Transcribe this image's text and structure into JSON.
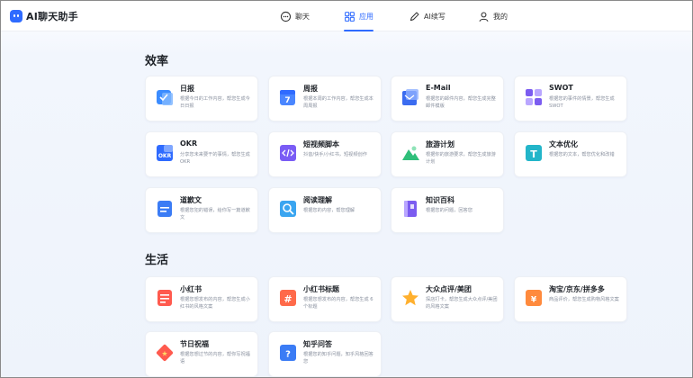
{
  "header": {
    "app_name": "AI聊天助手",
    "nav": [
      {
        "label": "聊天",
        "icon": "chat-bubble-icon",
        "active": false
      },
      {
        "label": "应用",
        "icon": "grid-icon",
        "active": true
      },
      {
        "label": "AI续写",
        "icon": "pen-icon",
        "active": false
      },
      {
        "label": "我的",
        "icon": "user-icon",
        "active": false
      }
    ]
  },
  "colors": {
    "accent": "#2f6bff"
  },
  "sections": [
    {
      "title": "效率",
      "cards": [
        {
          "title": "日报",
          "desc": "根据今日的工作内容，帮您生成今日日报",
          "icon": "daily-report-icon",
          "color": "#3b8cff"
        },
        {
          "title": "周报",
          "desc": "根据本周的工作内容，帮您生成本周周报",
          "icon": "weekly-report-icon",
          "color": "#4a86ff"
        },
        {
          "title": "E-Mail",
          "desc": "根据您的邮件内容，帮您生成完整邮件模版",
          "icon": "email-icon",
          "color": "#3b6cf0"
        },
        {
          "title": "SWOT",
          "desc": "根据您的事件的情景，帮您生成 SWOT",
          "icon": "swot-icon",
          "color": "#7b5cf0"
        },
        {
          "title": "OKR",
          "desc": "分享您未来要干的事情，帮您生成 OKR",
          "icon": "okr-icon",
          "color": "#2f6bff"
        },
        {
          "title": "短视频脚本",
          "desc": "抖音/快手/小红书，短视频创作",
          "icon": "video-script-icon",
          "color": "#7a5cf5"
        },
        {
          "title": "旅游计划",
          "desc": "根据你的旅游要求，帮您生成旅游计划",
          "icon": "travel-icon",
          "color": "#2fbf7a"
        },
        {
          "title": "文本优化",
          "desc": "根据您的文本，帮您优化和改错",
          "icon": "text-optimize-icon",
          "color": "#23b5c9"
        },
        {
          "title": "道歉文",
          "desc": "根据您犯的错误，给你写一篇道歉文",
          "icon": "apology-icon",
          "color": "#3b7cf5"
        },
        {
          "title": "阅读理解",
          "desc": "根据您的内容，帮您理解",
          "icon": "reading-icon",
          "color": "#3aa5f0"
        },
        {
          "title": "知识百科",
          "desc": "根据您的问题，回答您",
          "icon": "encyclopedia-icon",
          "color": "#7b5cf0"
        }
      ]
    },
    {
      "title": "生活",
      "cards": [
        {
          "title": "小红书",
          "desc": "根据您想发布的内容，帮您生成小红书的风格文案",
          "icon": "xiaohongshu-icon",
          "color": "#ff5a4e"
        },
        {
          "title": "小红书标题",
          "desc": "根据您想发布的内容，帮您生成 6 个标题",
          "icon": "hashtag-icon",
          "color": "#ff6a4a"
        },
        {
          "title": "大众点评/美团",
          "desc": "探店打卡，帮您生成大众点评/美团的风格文案",
          "icon": "star-icon",
          "color": "#ffb02e"
        },
        {
          "title": "淘宝/京东/拼多多",
          "desc": "商品评价，帮您生成购物风格文案",
          "icon": "shopping-icon",
          "color": "#ff8a3d"
        },
        {
          "title": "节日祝福",
          "desc": "根据您想过节的内容，帮你写祝福语",
          "icon": "festival-icon",
          "color": "#ff5a4e"
        },
        {
          "title": "知乎问答",
          "desc": "根据您的知乎问题，知乎风格回答您",
          "icon": "zhihu-icon",
          "color": "#3b7cf5"
        }
      ]
    }
  ]
}
